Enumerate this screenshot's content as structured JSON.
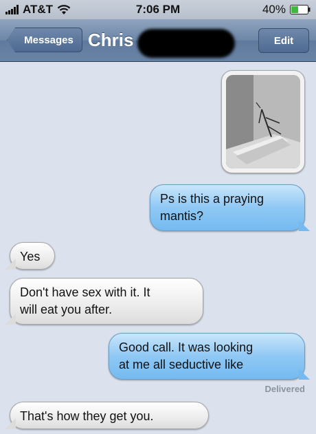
{
  "status_bar": {
    "carrier": "AT&T",
    "time": "7:06 PM",
    "battery": "40%"
  },
  "nav": {
    "back_label": "Messages",
    "contact_name": "Chris",
    "edit_label": "Edit"
  },
  "messages": [
    {
      "type": "photo",
      "direction": "received"
    },
    {
      "direction": "sent",
      "text_lines": [
        "Ps is this a praying",
        "mantis?"
      ]
    },
    {
      "direction": "received",
      "text_lines": [
        "Yes"
      ]
    },
    {
      "direction": "received",
      "text_lines": [
        "Don't have sex with it. It",
        "will eat you after."
      ]
    },
    {
      "direction": "sent",
      "text_lines": [
        "Good call. It was looking",
        "at me all seductive like"
      ]
    },
    {
      "direction": "received",
      "text_lines": [
        "That's how they get you."
      ]
    }
  ],
  "delivered_label": "Delivered",
  "colors": {
    "sent_bubble": "#8fc8f4",
    "received_bubble": "#ececec",
    "nav_bar": "#6d87a8",
    "background": "#dbe2ed"
  }
}
